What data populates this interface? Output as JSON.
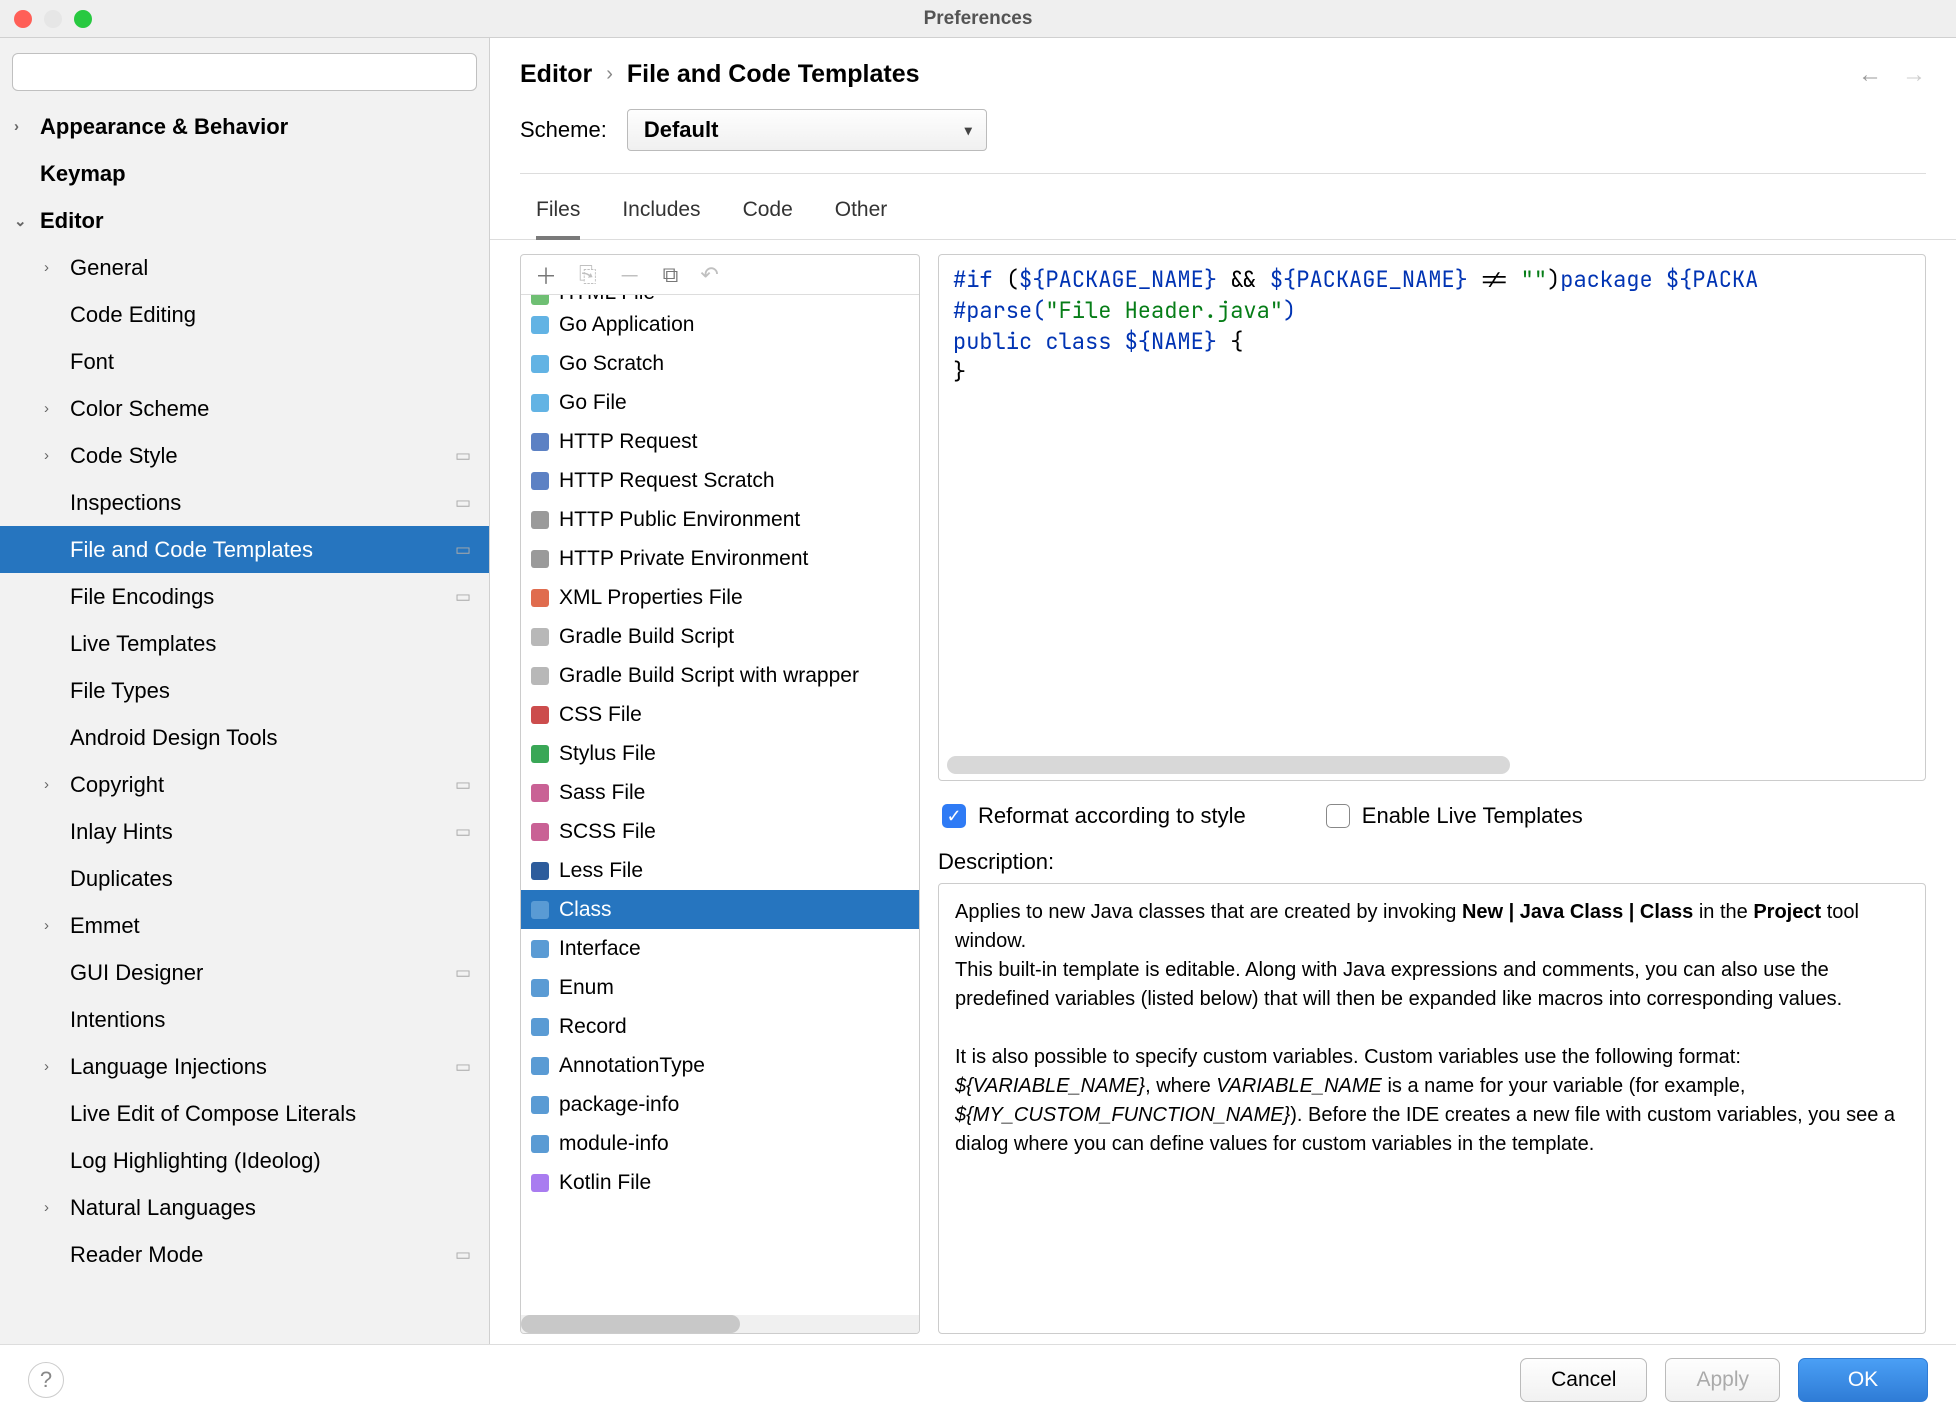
{
  "window": {
    "title": "Preferences"
  },
  "search": {
    "placeholder": ""
  },
  "sidebar": [
    {
      "label": "Appearance & Behavior",
      "level": 0,
      "bold": true,
      "chev": "right"
    },
    {
      "label": "Keymap",
      "level": 0,
      "bold": true
    },
    {
      "label": "Editor",
      "level": 0,
      "bold": true,
      "chev": "down"
    },
    {
      "label": "General",
      "level": 1,
      "chev": "right"
    },
    {
      "label": "Code Editing",
      "level": 1
    },
    {
      "label": "Font",
      "level": 1
    },
    {
      "label": "Color Scheme",
      "level": 1,
      "chev": "right"
    },
    {
      "label": "Code Style",
      "level": 1,
      "chev": "right",
      "gutter": true
    },
    {
      "label": "Inspections",
      "level": 1,
      "gutter": true
    },
    {
      "label": "File and Code Templates",
      "level": 1,
      "selected": true,
      "gutter": true
    },
    {
      "label": "File Encodings",
      "level": 1,
      "gutter": true
    },
    {
      "label": "Live Templates",
      "level": 1
    },
    {
      "label": "File Types",
      "level": 1
    },
    {
      "label": "Android Design Tools",
      "level": 1
    },
    {
      "label": "Copyright",
      "level": 1,
      "chev": "right",
      "gutter": true
    },
    {
      "label": "Inlay Hints",
      "level": 1,
      "gutter": true
    },
    {
      "label": "Duplicates",
      "level": 1
    },
    {
      "label": "Emmet",
      "level": 1,
      "chev": "right"
    },
    {
      "label": "GUI Designer",
      "level": 1,
      "gutter": true
    },
    {
      "label": "Intentions",
      "level": 1
    },
    {
      "label": "Language Injections",
      "level": 1,
      "chev": "right",
      "gutter": true
    },
    {
      "label": "Live Edit of Compose Literals",
      "level": 1
    },
    {
      "label": "Log Highlighting (Ideolog)",
      "level": 1
    },
    {
      "label": "Natural Languages",
      "level": 1,
      "chev": "right"
    },
    {
      "label": "Reader Mode",
      "level": 1,
      "gutter": true
    }
  ],
  "breadcrumb": {
    "parent": "Editor",
    "current": "File and Code Templates"
  },
  "scheme": {
    "label": "Scheme:",
    "value": "Default"
  },
  "tabs": [
    "Files",
    "Includes",
    "Code",
    "Other"
  ],
  "templates": [
    {
      "label": "HTML File",
      "ic": "ic-h",
      "clipped": true
    },
    {
      "label": "Go Application",
      "ic": "ic-go"
    },
    {
      "label": "Go Scratch",
      "ic": "ic-go"
    },
    {
      "label": "Go File",
      "ic": "ic-go"
    },
    {
      "label": "HTTP Request",
      "ic": "ic-api"
    },
    {
      "label": "HTTP Request Scratch",
      "ic": "ic-api"
    },
    {
      "label": "HTTP Public Environment",
      "ic": "ic-http"
    },
    {
      "label": "HTTP Private Environment",
      "ic": "ic-http"
    },
    {
      "label": "XML Properties File",
      "ic": "ic-xml"
    },
    {
      "label": "Gradle Build Script",
      "ic": "ic-gr"
    },
    {
      "label": "Gradle Build Script with wrapper",
      "ic": "ic-gr"
    },
    {
      "label": "CSS File",
      "ic": "ic-css"
    },
    {
      "label": "Stylus File",
      "ic": "ic-styl"
    },
    {
      "label": "Sass File",
      "ic": "ic-sass"
    },
    {
      "label": "SCSS File",
      "ic": "ic-sass"
    },
    {
      "label": "Less File",
      "ic": "ic-less"
    },
    {
      "label": "Class",
      "ic": "ic-java",
      "selected": true
    },
    {
      "label": "Interface",
      "ic": "ic-java"
    },
    {
      "label": "Enum",
      "ic": "ic-java"
    },
    {
      "label": "Record",
      "ic": "ic-java"
    },
    {
      "label": "AnnotationType",
      "ic": "ic-java"
    },
    {
      "label": "package-info",
      "ic": "ic-java"
    },
    {
      "label": "module-info",
      "ic": "ic-java"
    },
    {
      "label": "Kotlin File",
      "ic": "ic-kt"
    }
  ],
  "code": {
    "tokens": [
      {
        "c": "kw",
        "t": "#if "
      },
      {
        "c": "plain",
        "t": "("
      },
      {
        "c": "var",
        "t": "${PACKAGE_NAME}"
      },
      {
        "c": "plain",
        "t": " && "
      },
      {
        "c": "var",
        "t": "${PACKAGE_NAME}"
      },
      {
        "c": "plain",
        "t": " != "
      },
      {
        "c": "str",
        "t": "\"\""
      },
      {
        "c": "plain",
        "t": ")"
      },
      {
        "c": "kw",
        "t": "package "
      },
      {
        "c": "var",
        "t": "${PACKA"
      },
      {
        "c": "nl",
        "t": "\n"
      },
      {
        "c": "kw",
        "t": "#parse("
      },
      {
        "c": "str",
        "t": "\"File Header.java\""
      },
      {
        "c": "kw",
        "t": ")"
      },
      {
        "c": "nl",
        "t": "\n"
      },
      {
        "c": "kw",
        "t": "public class "
      },
      {
        "c": "var",
        "t": "${NAME}"
      },
      {
        "c": "plain",
        "t": " {"
      },
      {
        "c": "nl",
        "t": "\n"
      },
      {
        "c": "plain",
        "t": "}"
      }
    ]
  },
  "options": {
    "reformat": {
      "label": "Reformat according to style",
      "checked": true
    },
    "live": {
      "label": "Enable Live Templates",
      "checked": false
    }
  },
  "description": {
    "label": "Description:",
    "p1a": "Applies to new Java classes that are created by invoking ",
    "p1b": "New | Java Class | Class",
    "p1c": " in the ",
    "p1d": "Project",
    "p1e": " tool window.",
    "p2": "This built-in template is editable. Along with Java expressions and comments, you can also use the predefined variables (listed below) that will then be expanded like macros into corresponding values.",
    "p3a": "It is also possible to specify custom variables. Custom variables use the following format: ",
    "p3b": "${VARIABLE_NAME}",
    "p3c": ", where ",
    "p3d": "VARIABLE_NAME",
    "p3e": " is a name for your variable (for example, ",
    "p3f": "${MY_CUSTOM_FUNCTION_NAME}",
    "p3g": "). Before the IDE creates a new file with custom variables, you see a dialog where you can define values for custom variables in the template."
  },
  "footer": {
    "cancel": "Cancel",
    "apply": "Apply",
    "ok": "OK"
  }
}
